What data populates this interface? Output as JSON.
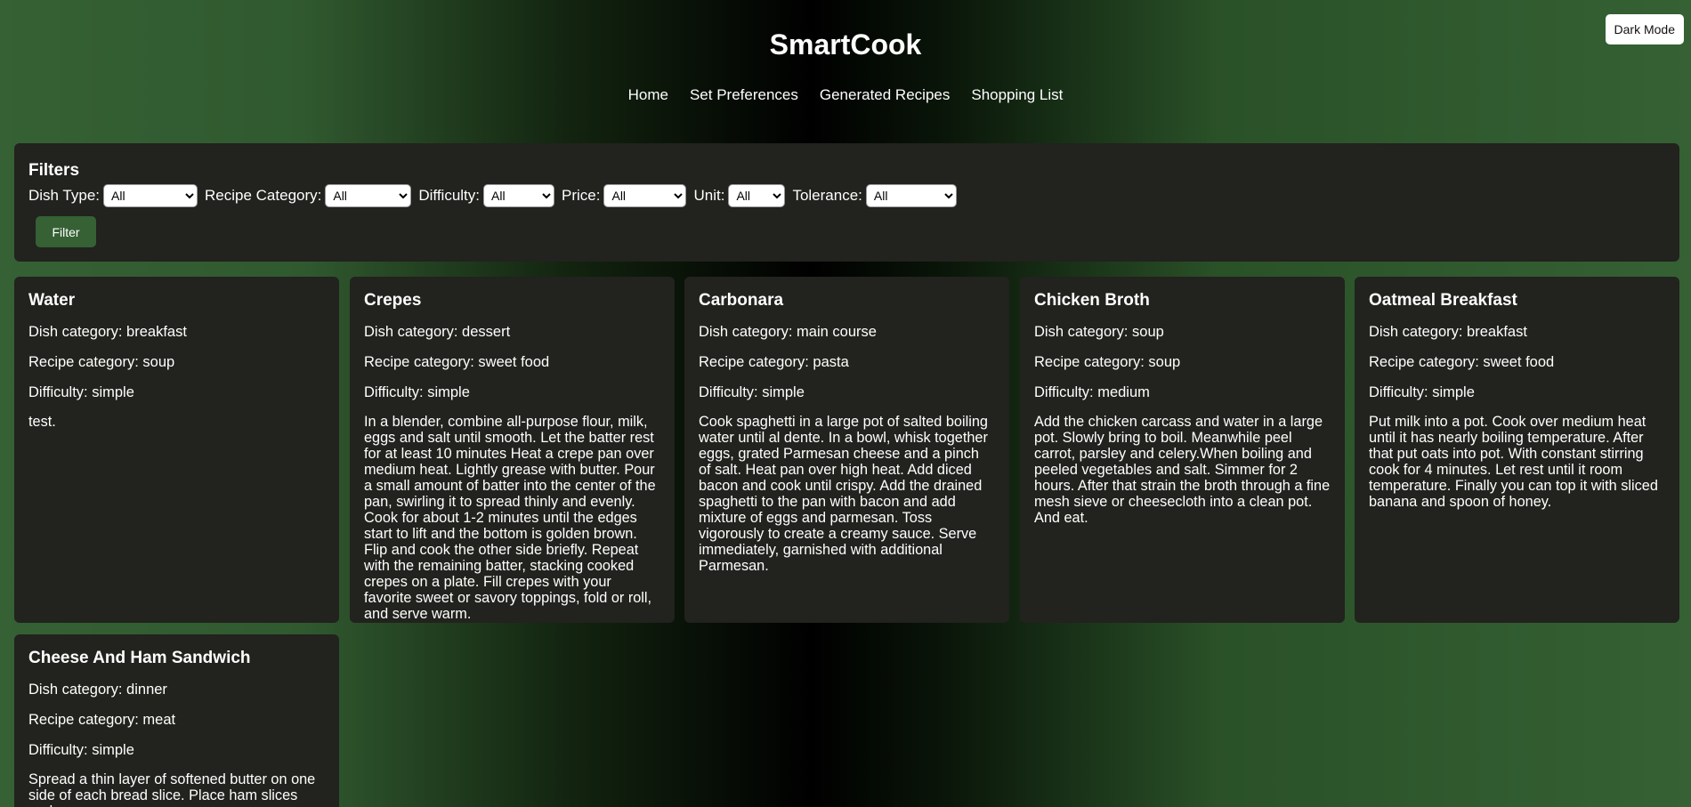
{
  "header": {
    "title": "SmartCook",
    "dark_mode_label": "Dark Mode",
    "nav": [
      "Home",
      "Set Preferences",
      "Generated Recipes",
      "Shopping List"
    ]
  },
  "filters": {
    "heading": "Filters",
    "fields": [
      {
        "label": "Dish Type:",
        "value": "All"
      },
      {
        "label": "Recipe Category:",
        "value": "All"
      },
      {
        "label": "Difficulty:",
        "value": "All"
      },
      {
        "label": "Price:",
        "value": "All"
      },
      {
        "label": "Unit:",
        "value": "All"
      },
      {
        "label": "Tolerance:",
        "value": "All"
      }
    ],
    "button_label": "Filter"
  },
  "recipes": [
    {
      "title": "Water",
      "dish": "Dish category: breakfast",
      "category": "Recipe category: soup",
      "difficulty": "Difficulty: simple",
      "instructions": "test."
    },
    {
      "title": "Crepes",
      "dish": "Dish category: dessert",
      "category": "Recipe category: sweet food",
      "difficulty": "Difficulty: simple",
      "instructions": "In a blender, combine all-purpose flour, milk, eggs and salt until smooth. Let the batter rest for at least 10 minutes Heat a crepe pan over medium heat. Lightly grease with butter. Pour a small amount of batter into the center of the pan, swirling it to spread thinly and evenly. Cook for about 1-2 minutes until the edges start to lift and the bottom is golden brown. Flip and cook the other side briefly. Repeat with the remaining batter, stacking cooked crepes on a plate. Fill crepes with your favorite sweet or savory toppings, fold or roll, and serve warm."
    },
    {
      "title": "Carbonara",
      "dish": "Dish category: main course",
      "category": "Recipe category: pasta",
      "difficulty": "Difficulty: simple",
      "instructions": "Cook spaghetti in a large pot of salted boiling water until al dente. In a bowl, whisk together eggs, grated Parmesan cheese and a pinch of salt. Heat pan over high heat. Add diced bacon and cook until crispy. Add the drained spaghetti to the pan with bacon and add mixture of eggs and parmesan. Toss vigorously to create a creamy sauce. Serve immediately, garnished with additional Parmesan."
    },
    {
      "title": "Chicken Broth",
      "dish": "Dish category: soup",
      "category": "Recipe category: soup",
      "difficulty": "Difficulty: medium",
      "instructions": "Add the chicken carcass and water in a large pot. Slowly bring to boil. Meanwhile peel carrot, parsley and celery.When boiling and peeled vegetables and salt. Simmer for 2 hours. After that strain the broth through a fine mesh sieve or cheesecloth into a clean pot. And eat."
    },
    {
      "title": "Oatmeal Breakfast",
      "dish": "Dish category: breakfast",
      "category": "Recipe category: sweet food",
      "difficulty": "Difficulty: simple",
      "instructions": "Put milk into a pot. Cook over medium heat until it has nearly boiling temperature. After that put oats into pot. With constant stirring cook for 4 minutes. Let rest until it room temperature. Finally you can top it with sliced banana and spoon of honey."
    },
    {
      "title": "Cheese And Ham Sandwich",
      "dish": "Dish category: dinner",
      "category": "Recipe category: meat",
      "difficulty": "Difficulty: simple",
      "instructions": "Spread a thin layer of softened butter on one side of each bread slice. Place ham slices and"
    }
  ]
}
